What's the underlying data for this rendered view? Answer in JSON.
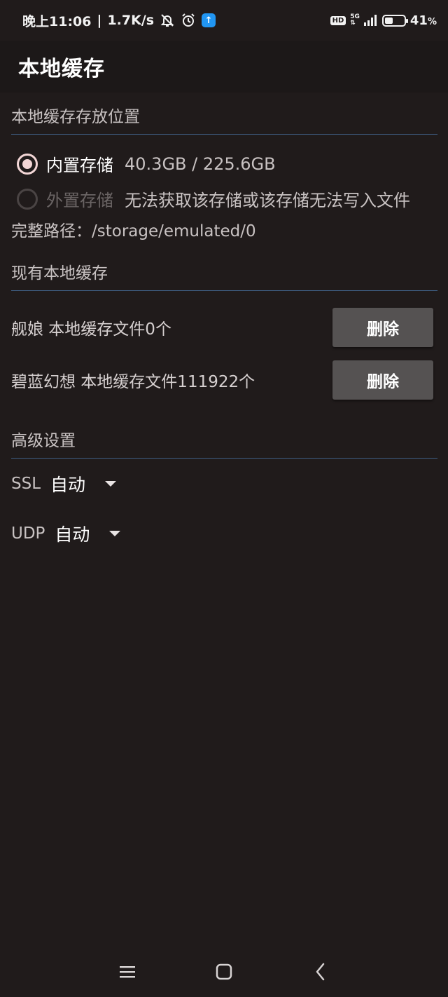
{
  "status_bar": {
    "time": "晚上11:06",
    "speed": "1.7K/s",
    "battery_percent": "41",
    "battery_unit": "%",
    "network": "5G",
    "hd_label": "HD",
    "icons": [
      "mute-icon",
      "alarm-icon",
      "upload-icon",
      "hd-icon",
      "signal-icon",
      "battery-icon"
    ]
  },
  "app_bar": {
    "title": "本地缓存"
  },
  "storage_section": {
    "header": "本地缓存存放位置",
    "internal": {
      "label": "内置存储",
      "info": "40.3GB / 225.6GB",
      "selected": true
    },
    "external": {
      "label": "外置存储",
      "info": "无法获取该存储或该存储无法写入文件",
      "selected": false
    },
    "path_label": "完整路径：",
    "path_value": "/storage/emulated/0"
  },
  "cache_section": {
    "header": "现有本地缓存",
    "items": [
      {
        "text": "舰娘 本地缓存文件0个",
        "button": "删除"
      },
      {
        "text": "碧蓝幻想 本地缓存文件111922个",
        "button": "删除"
      }
    ]
  },
  "advanced_section": {
    "header": "高级设置",
    "ssl": {
      "label": "SSL",
      "value": "自动"
    },
    "udp": {
      "label": "UDP",
      "value": "自动"
    }
  },
  "nav_bar": {
    "icons": [
      "menu-icon",
      "home-icon",
      "back-icon"
    ]
  }
}
